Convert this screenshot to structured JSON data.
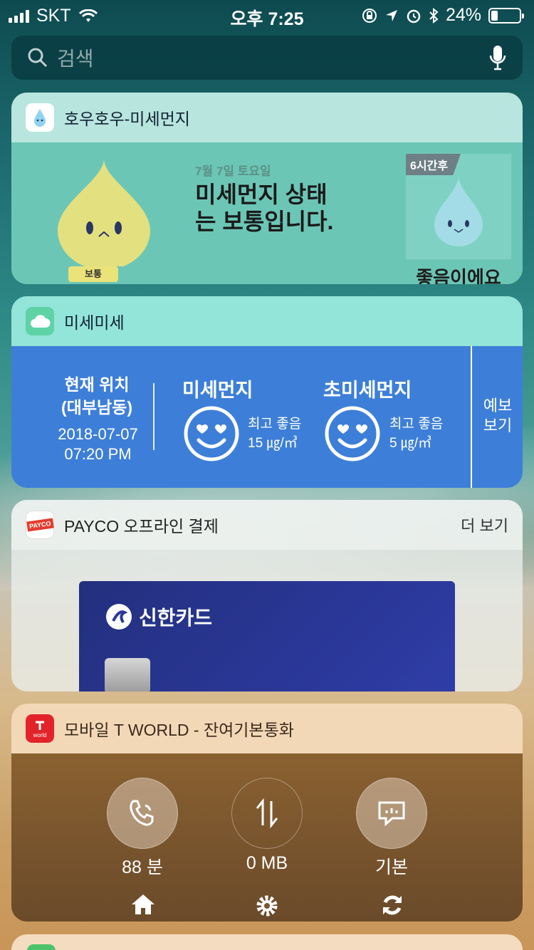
{
  "status_bar": {
    "carrier": "SKT",
    "time": "오후 7:25",
    "battery": "24%",
    "battery_level": 0.24
  },
  "search": {
    "placeholder": "검색"
  },
  "widgets": {
    "hou": {
      "app_name": "호우호우-미세먼지",
      "date": "7월 7일 토요일",
      "headline": "미세먼지 상태는 보통입니다.",
      "status": "보통",
      "forecast_tag": "6시간후",
      "forecast_text": "좋음이에요"
    },
    "misemise": {
      "app_name": "미세미세",
      "location_label": "현재 위치",
      "location_name": "(대부남동)",
      "date": "2018-07-07",
      "time": "07:20 PM",
      "pm10": {
        "title": "미세먼지",
        "grade": "최고 좋음",
        "value": "15 ㎍/㎥"
      },
      "pm25": {
        "title": "초미세먼지",
        "grade": "최고 좋음",
        "value": "5 ㎍/㎥"
      },
      "forecast_link": "예보 보기"
    },
    "payco": {
      "app_name": "PAYCO 오프라인 결제",
      "more": "더 보기",
      "card_brand": "신한카드",
      "icon_text": "PAYCO"
    },
    "tworld": {
      "app_name": "모바일 T WORLD - 잔여기본통화",
      "icon_text": "world",
      "items": [
        {
          "label": "88 분"
        },
        {
          "label": "0 MB"
        },
        {
          "label": "기본"
        }
      ]
    }
  },
  "colors": {
    "misemise_blue": "#3d7fd8",
    "hou_green": "#6cc6b6",
    "card_navy": "#2a3797",
    "tworld_brown": "#7a5530"
  }
}
